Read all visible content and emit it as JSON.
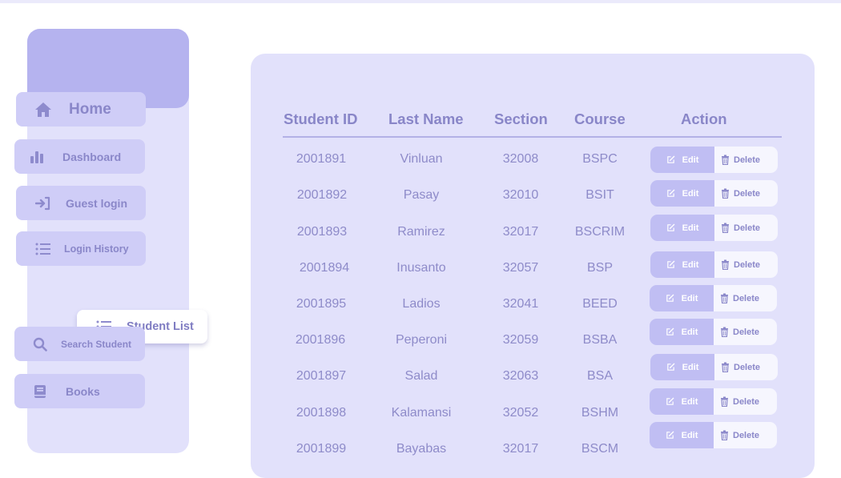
{
  "sidebar": {
    "items": [
      {
        "label": "Home",
        "icon": "home-icon"
      },
      {
        "label": "Dashboard",
        "icon": "bar-chart-icon"
      },
      {
        "label": "Guest login",
        "icon": "login-icon"
      },
      {
        "label": "Login History",
        "icon": "list-icon"
      },
      {
        "label": "Student List",
        "icon": "list-icon",
        "active": true
      },
      {
        "label": "Search Student",
        "icon": "search-icon"
      },
      {
        "label": "Books",
        "icon": "book-icon"
      }
    ]
  },
  "table": {
    "headers": [
      "Student ID",
      "Last Name",
      "Section",
      "Course",
      "Action"
    ],
    "rows": [
      {
        "id": "2001891",
        "last_name": "Vinluan",
        "section": "32008",
        "course": "BSPC"
      },
      {
        "id": "2001892",
        "last_name": "Pasay",
        "section": "32010",
        "course": "BSIT"
      },
      {
        "id": "2001893",
        "last_name": "Ramirez",
        "section": "32017",
        "course": "BSCRIM"
      },
      {
        "id": "2001894",
        "last_name": "Inusanto",
        "section": "32057",
        "course": "BSP"
      },
      {
        "id": "2001895",
        "last_name": "Ladios",
        "section": "32041",
        "course": "BEED"
      },
      {
        "id": "2001896",
        "last_name": "Peperoni",
        "section": "32059",
        "course": "BSBA"
      },
      {
        "id": "2001897",
        "last_name": "Salad",
        "section": "32063",
        "course": "BSA"
      },
      {
        "id": "2001898",
        "last_name": "Kalamansi",
        "section": "32052",
        "course": "BSHM"
      },
      {
        "id": "2001899",
        "last_name": "Bayabas",
        "section": "32017",
        "course": "BSCM"
      }
    ],
    "edit_label": "Edit",
    "delete_label": "Delete"
  },
  "colors": {
    "accent": "#b5b3ef",
    "panel": "#e2e1fb",
    "text": "#8e8bc9"
  }
}
